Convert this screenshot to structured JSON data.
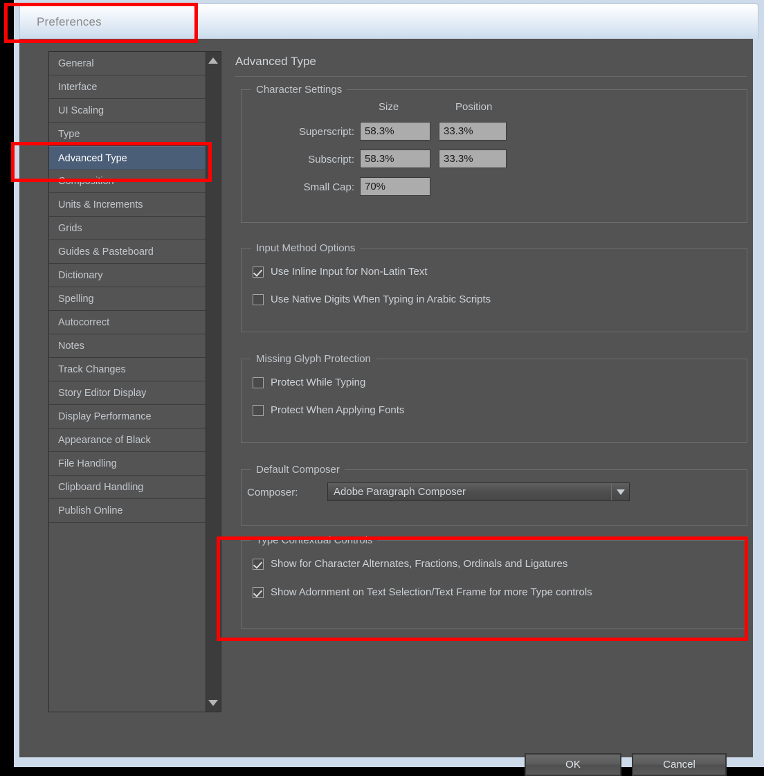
{
  "window": {
    "title": "Preferences"
  },
  "sidebar": {
    "items": [
      {
        "label": "General",
        "selected": false
      },
      {
        "label": "Interface",
        "selected": false
      },
      {
        "label": "UI Scaling",
        "selected": false
      },
      {
        "label": "Type",
        "selected": false
      },
      {
        "label": "Advanced Type",
        "selected": true
      },
      {
        "label": "Composition",
        "selected": false
      },
      {
        "label": "Units & Increments",
        "selected": false
      },
      {
        "label": "Grids",
        "selected": false
      },
      {
        "label": "Guides & Pasteboard",
        "selected": false
      },
      {
        "label": "Dictionary",
        "selected": false
      },
      {
        "label": "Spelling",
        "selected": false
      },
      {
        "label": "Autocorrect",
        "selected": false
      },
      {
        "label": "Notes",
        "selected": false
      },
      {
        "label": "Track Changes",
        "selected": false
      },
      {
        "label": "Story Editor Display",
        "selected": false
      },
      {
        "label": "Display Performance",
        "selected": false
      },
      {
        "label": "Appearance of Black",
        "selected": false
      },
      {
        "label": "File Handling",
        "selected": false
      },
      {
        "label": "Clipboard Handling",
        "selected": false
      },
      {
        "label": "Publish Online",
        "selected": false
      }
    ]
  },
  "main": {
    "page_title": "Advanced Type",
    "character_settings": {
      "legend": "Character Settings",
      "col_size": "Size",
      "col_position": "Position",
      "rows": [
        {
          "label": "Superscript:",
          "size": "58.3%",
          "position": "33.3%"
        },
        {
          "label": "Subscript:",
          "size": "58.3%",
          "position": "33.3%"
        },
        {
          "label": "Small Cap:",
          "size": "70%",
          "position": null
        }
      ]
    },
    "input_method_options": {
      "legend": "Input Method Options",
      "checkboxes": [
        {
          "label": "Use Inline Input for Non-Latin Text",
          "checked": true
        },
        {
          "label": "Use Native Digits When Typing in Arabic Scripts",
          "checked": false
        }
      ]
    },
    "missing_glyph_protection": {
      "legend": "Missing Glyph Protection",
      "checkboxes": [
        {
          "label": "Protect While Typing",
          "checked": false
        },
        {
          "label": "Protect When Applying Fonts",
          "checked": false
        }
      ]
    },
    "default_composer": {
      "legend": "Default Composer",
      "field_label": "Composer:",
      "value": "Adobe Paragraph Composer"
    },
    "type_contextual_controls": {
      "legend": "Type Contextual Controls",
      "checkboxes": [
        {
          "label": "Show for Character Alternates, Fractions, Ordinals and Ligatures",
          "checked": true
        },
        {
          "label": "Show Adornment on Text Selection/Text Frame for more Type controls",
          "checked": true
        }
      ]
    }
  },
  "footer": {
    "ok_label": "OK",
    "cancel_label": "Cancel"
  },
  "colors": {
    "dialog_background": "#535353",
    "selection_blue": "#4b5e78",
    "annotation_red": "#fe0000",
    "field_background": "#acacac"
  }
}
